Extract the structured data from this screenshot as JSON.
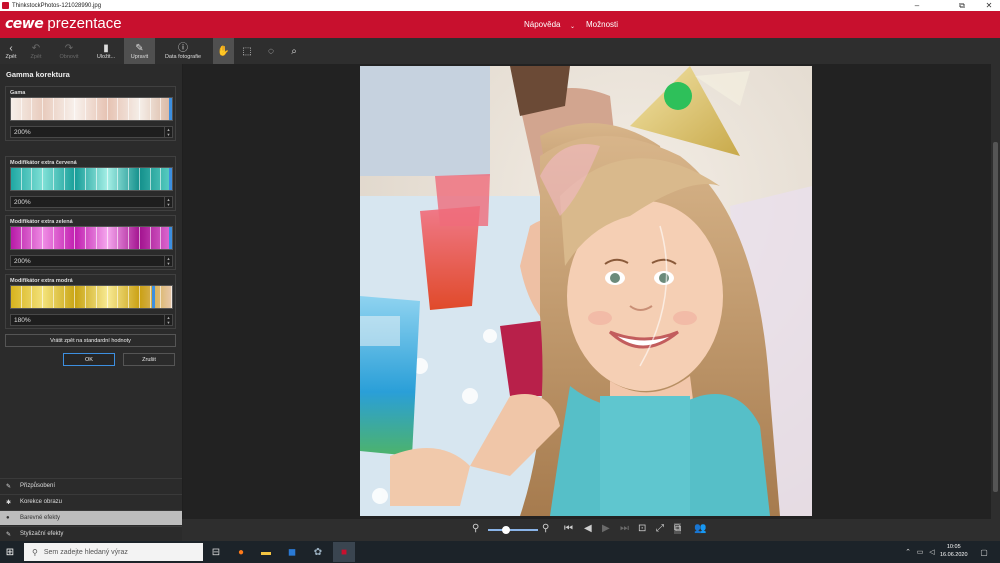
{
  "window": {
    "title": "ThinkstockPhotos-121028990.jpg",
    "minimize": "–",
    "restore": "⧉",
    "close": "✕"
  },
  "brand": {
    "logo_bold": "cewe",
    "logo_text": " prezentace"
  },
  "header": {
    "help": "Nápověda",
    "help_caret": "⌄",
    "options": "Možnosti"
  },
  "toolbar": {
    "back": {
      "label": "Zpět",
      "icon": "‹"
    },
    "undo": {
      "label": "Zpět",
      "icon": "↶"
    },
    "redo": {
      "label": "Obnovit",
      "icon": "↷"
    },
    "save": {
      "label": "Uložit...",
      "icon": "▮"
    },
    "edit": {
      "label": "Upravit",
      "icon": "✎"
    },
    "info": {
      "label": "Data fotografie",
      "icon": "ⓘ"
    },
    "hand_icon": "✋",
    "rect_icon": "⬚",
    "ellipse_icon": "◌",
    "lasso_icon": "⌕"
  },
  "panel": {
    "title": "Gamma korektura",
    "groups": [
      {
        "label": "Gama",
        "value": "200%"
      },
      {
        "label": "Modifikátor extra červená",
        "value": "200%"
      },
      {
        "label": "Modifikátor extra zelená",
        "value": "200%"
      },
      {
        "label": "Modifikátor extra modrá",
        "value": "180%"
      }
    ],
    "reset_label": "Vrátit zpět na standardní hodnoty",
    "ok_label": "OK",
    "cancel_label": "Zrušit",
    "accordion": [
      {
        "label": "Přizpůsobení",
        "icon": "✎"
      },
      {
        "label": "Korekce obrazu",
        "icon": "✱"
      },
      {
        "label": "Barevné efekty",
        "icon": "●"
      },
      {
        "label": "Stylizační efekty",
        "icon": "✎"
      }
    ]
  },
  "bottom": {
    "zoom_out_icon": "⚲",
    "zoom_in_icon": "⚲",
    "zoom_level": 0.35
  },
  "taskbar": {
    "search_placeholder": "Sem zadejte hledaný výraz",
    "time": "10:05",
    "date": "16.06.2020"
  },
  "colors": {
    "brand_red": "#c8102e",
    "accent_blue": "#3d8fe0"
  }
}
